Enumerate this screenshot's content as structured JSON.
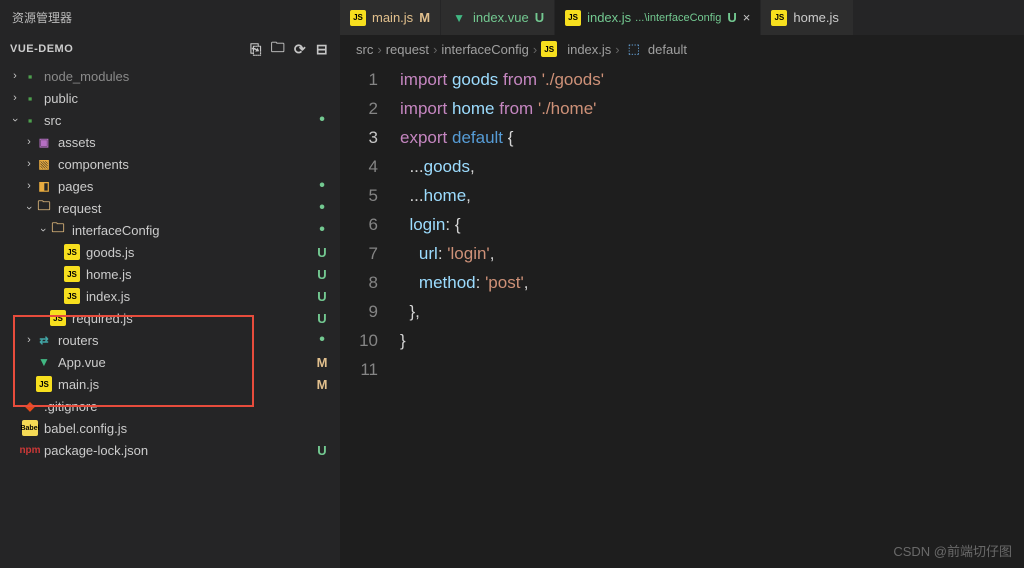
{
  "header": {
    "title": "资源管理器",
    "menu": "···"
  },
  "project": {
    "name": "VUE-DEMO",
    "actions": [
      "new-file",
      "new-folder",
      "refresh",
      "collapse"
    ]
  },
  "tree": [
    {
      "name": "node_modules",
      "icon": "folder",
      "depth": 0,
      "chev": "closed",
      "dim": true
    },
    {
      "name": "public",
      "icon": "folder",
      "depth": 0,
      "chev": "closed"
    },
    {
      "name": "src",
      "icon": "folder",
      "depth": 0,
      "chev": "open",
      "status": "dot"
    },
    {
      "name": "assets",
      "icon": "img",
      "depth": 1,
      "chev": "closed"
    },
    {
      "name": "components",
      "icon": "comp",
      "depth": 1,
      "chev": "closed"
    },
    {
      "name": "pages",
      "icon": "pages",
      "depth": 1,
      "chev": "closed",
      "status": "dot"
    },
    {
      "name": "request",
      "icon": "folder-y",
      "depth": 1,
      "chev": "open",
      "status": "dot"
    },
    {
      "name": "interfaceConfig",
      "icon": "folder-y",
      "depth": 2,
      "chev": "open",
      "status": "dot"
    },
    {
      "name": "goods.js",
      "icon": "js",
      "depth": 3,
      "status": "U"
    },
    {
      "name": "home.js",
      "icon": "js",
      "depth": 3,
      "status": "U"
    },
    {
      "name": "index.js",
      "icon": "js",
      "depth": 3,
      "status": "U"
    },
    {
      "name": "required.js",
      "icon": "js",
      "depth": 2,
      "status": "U"
    },
    {
      "name": "routers",
      "icon": "route",
      "depth": 1,
      "chev": "closed",
      "status": "dot"
    },
    {
      "name": "App.vue",
      "icon": "vue",
      "depth": 1,
      "status": "M"
    },
    {
      "name": "main.js",
      "icon": "js",
      "depth": 1,
      "status": "M"
    },
    {
      "name": ".gitignore",
      "icon": "git",
      "depth": 0
    },
    {
      "name": "babel.config.js",
      "icon": "babel",
      "depth": 0
    },
    {
      "name": "package-lock.json",
      "icon": "npm",
      "depth": 0,
      "status": "U"
    }
  ],
  "tabs": [
    {
      "icon": "js",
      "label": "main.js",
      "status": "M",
      "cls": "mod"
    },
    {
      "icon": "vue",
      "label": "index.vue",
      "status": "U",
      "cls": "unt"
    },
    {
      "icon": "js",
      "label": "index.js",
      "suffix": "...\\interfaceConfig",
      "status": "U",
      "cls": "unt active",
      "close": true
    },
    {
      "icon": "js",
      "label": "home.js",
      "cls": ""
    }
  ],
  "breadcrumb": {
    "parts": [
      "src",
      "request",
      "interfaceConfig"
    ],
    "file": "index.js",
    "symbol": "default"
  },
  "code": {
    "lines": [
      [
        {
          "t": "import ",
          "c": "kw"
        },
        {
          "t": "goods ",
          "c": "var"
        },
        {
          "t": "from ",
          "c": "kw"
        },
        {
          "t": "'./goods'",
          "c": "str"
        }
      ],
      [
        {
          "t": "import ",
          "c": "kw"
        },
        {
          "t": "home ",
          "c": "var"
        },
        {
          "t": "from ",
          "c": "kw"
        },
        {
          "t": "'./home'",
          "c": "str"
        }
      ],
      [
        {
          "t": "export ",
          "c": "kw"
        },
        {
          "t": "default ",
          "c": "def"
        },
        {
          "t": "{",
          "c": "punct"
        }
      ],
      [
        {
          "t": "  ...",
          "c": "punct"
        },
        {
          "t": "goods",
          "c": "var"
        },
        {
          "t": ",",
          "c": "punct"
        }
      ],
      [
        {
          "t": "  ...",
          "c": "punct"
        },
        {
          "t": "home",
          "c": "var"
        },
        {
          "t": ",",
          "c": "punct"
        }
      ],
      [
        {
          "t": "  ",
          "c": ""
        },
        {
          "t": "login",
          "c": "prop"
        },
        {
          "t": ": {",
          "c": "punct"
        }
      ],
      [
        {
          "t": "    ",
          "c": ""
        },
        {
          "t": "url",
          "c": "prop"
        },
        {
          "t": ": ",
          "c": "punct"
        },
        {
          "t": "'login'",
          "c": "str"
        },
        {
          "t": ",",
          "c": "punct"
        }
      ],
      [
        {
          "t": "    ",
          "c": ""
        },
        {
          "t": "method",
          "c": "prop"
        },
        {
          "t": ": ",
          "c": "punct"
        },
        {
          "t": "'post'",
          "c": "str"
        },
        {
          "t": ",",
          "c": "punct"
        }
      ],
      [
        {
          "t": "  },",
          "c": "punct"
        }
      ],
      [
        {
          "t": "}",
          "c": "punct"
        }
      ],
      []
    ]
  },
  "watermark": "CSDN @前端切仔图",
  "iconText": {
    "js": "JS",
    "vue": "▼",
    "git": "◆",
    "babel": "Babel",
    "npm": "npm",
    "folder": "▪",
    "folder-y": "🗀",
    "img": "▣",
    "comp": "▧",
    "route": "⇄",
    "pages": "◧"
  }
}
